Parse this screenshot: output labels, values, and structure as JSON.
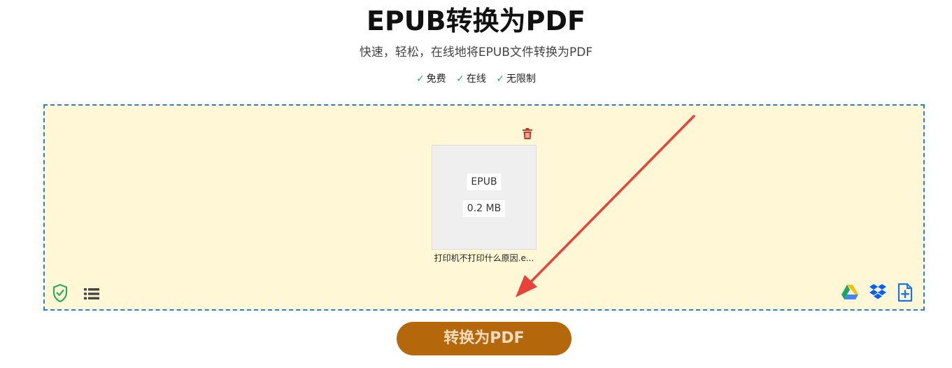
{
  "header": {
    "title": "EPUB转换为PDF",
    "subtitle": "快速，轻松，在线地将EPUB文件转换为PDF",
    "features": [
      {
        "check": "✓",
        "label": "免费"
      },
      {
        "check": "✓",
        "label": "在线"
      },
      {
        "check": "✓",
        "label": "无限制"
      }
    ]
  },
  "file": {
    "type": "EPUB",
    "size": "0.2 MB",
    "name": "打印机不打印什么原因.e..."
  },
  "icons": {
    "delete": "trash-icon",
    "security": "shield-check-icon",
    "list": "list-icon",
    "google_drive": "google-drive-icon",
    "dropbox": "dropbox-icon",
    "add_file": "add-file-icon"
  },
  "actions": {
    "convert_label": "转换为PDF"
  },
  "colors": {
    "dropzone_bg": "#fff7d6",
    "dropzone_border": "#2a7fd4",
    "button_bg": "#b5670c",
    "check": "#2fa860",
    "trash": "#c0392b",
    "annotation_arrow": "#e8433a"
  }
}
